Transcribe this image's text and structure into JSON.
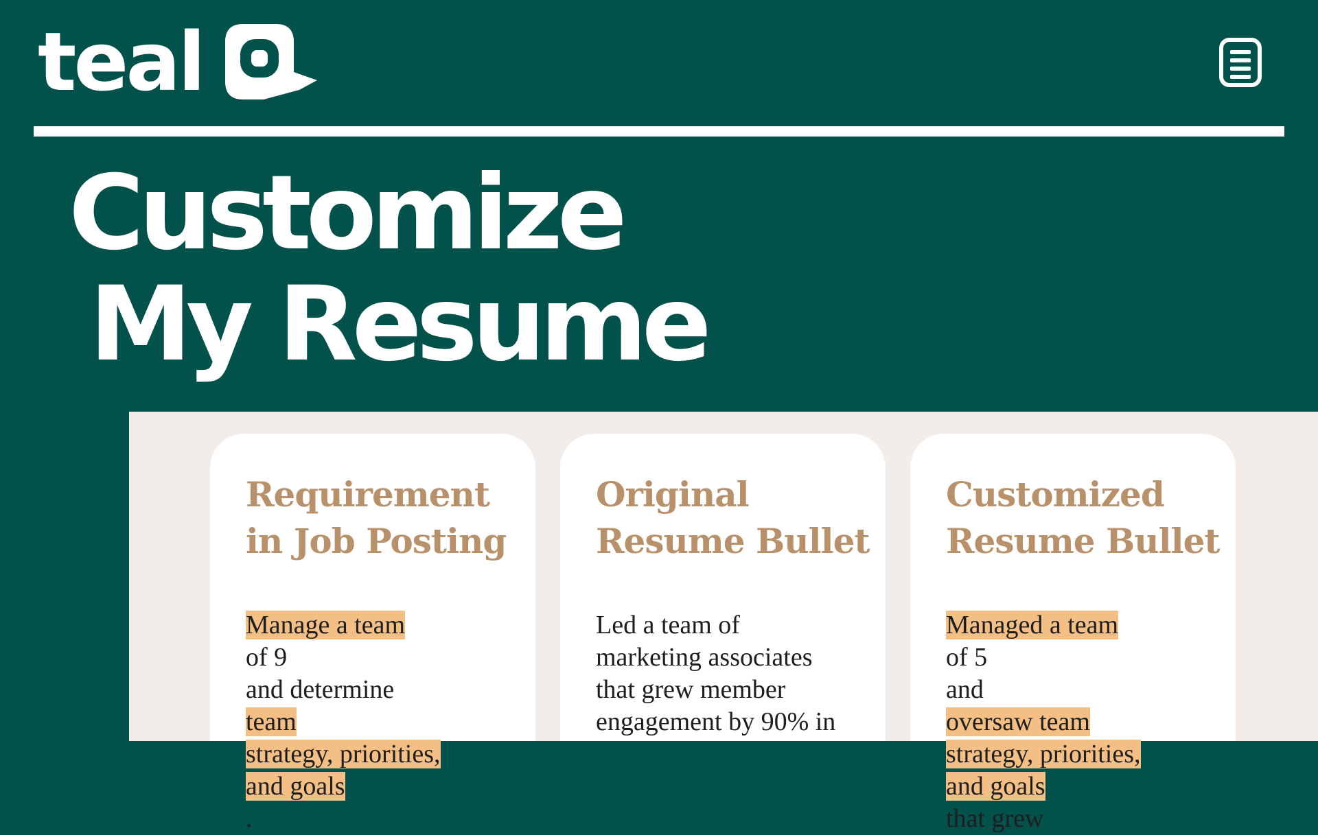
{
  "brand": {
    "name": "teal"
  },
  "header": {
    "menu_icon": "document-list-icon"
  },
  "headline": {
    "line1": "Customize",
    "line2": "My Resume"
  },
  "colors": {
    "background": "#02514a",
    "panel": "#f2ede8",
    "card": "#ffffff",
    "title": "#b8916b",
    "highlight": "#f4bf85",
    "text": "#1e1e1e"
  },
  "cards": [
    {
      "title": [
        "Requirement",
        "in Job Posting"
      ],
      "lines": [
        [
          {
            "t": "Manage a team",
            "h": true
          },
          {
            "t": " of 9",
            "h": false
          }
        ],
        [
          {
            "t": "and determine ",
            "h": false
          },
          {
            "t": "team",
            "h": true
          }
        ],
        [
          {
            "t": "strategy, priorities,",
            "h": true
          }
        ],
        [
          {
            "t": "and goals",
            "h": true
          },
          {
            "t": ".",
            "h": false
          }
        ]
      ]
    },
    {
      "title": [
        "Original",
        "Resume Bullet"
      ],
      "lines": [
        [
          {
            "t": "Led a team of",
            "h": false
          }
        ],
        [
          {
            "t": "marketing associates",
            "h": false
          }
        ],
        [
          {
            "t": "that grew member",
            "h": false
          }
        ],
        [
          {
            "t": "engagement by 90% in",
            "h": false
          }
        ]
      ]
    },
    {
      "title": [
        "Customized",
        "Resume Bullet"
      ],
      "lines": [
        [
          {
            "t": "Managed a team",
            "h": true
          },
          {
            "t": " of 5",
            "h": false
          }
        ],
        [
          {
            "t": "and ",
            "h": false
          },
          {
            "t": "oversaw team",
            "h": true
          }
        ],
        [
          {
            "t": "strategy, priorities,",
            "h": true
          }
        ],
        [
          {
            "t": "and goals",
            "h": true
          },
          {
            "t": " that grew",
            "h": false
          }
        ]
      ]
    }
  ]
}
